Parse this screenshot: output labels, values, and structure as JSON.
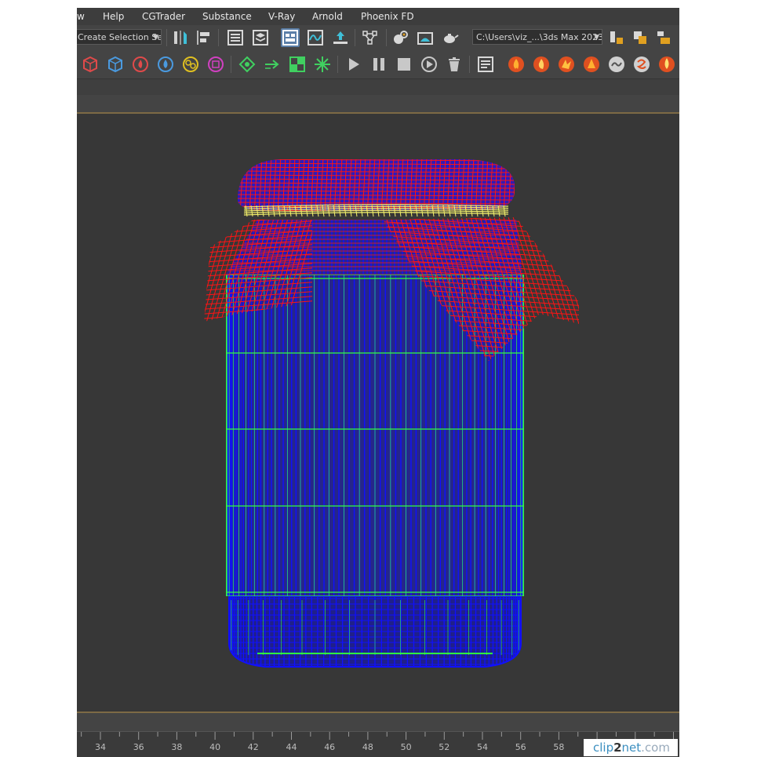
{
  "menubar": {
    "items": [
      {
        "label": "w"
      },
      {
        "label": "Help"
      },
      {
        "label": "CGTrader"
      },
      {
        "label": "Substance"
      },
      {
        "label": "V-Ray"
      },
      {
        "label": "Arnold"
      },
      {
        "label": "Phoenix FD"
      }
    ]
  },
  "toolbar": {
    "selection_set": "Create Selection Se",
    "project_path": "C:\\Users\\viz_...\\3ds Max 2023"
  },
  "timeline": {
    "ticks": [
      "34",
      "36",
      "38",
      "40",
      "42",
      "44",
      "46",
      "48",
      "50",
      "52",
      "54",
      "56",
      "58"
    ]
  },
  "watermark": {
    "left": "clip",
    "mid": "2",
    "right": "net",
    "suffix": ".com"
  },
  "colors": {
    "cloth": "#ff1414",
    "string": "#f2f06a",
    "jar_edges": "#1010ff",
    "jar_frame": "#30ff40",
    "viewport_bg": "#373737"
  }
}
